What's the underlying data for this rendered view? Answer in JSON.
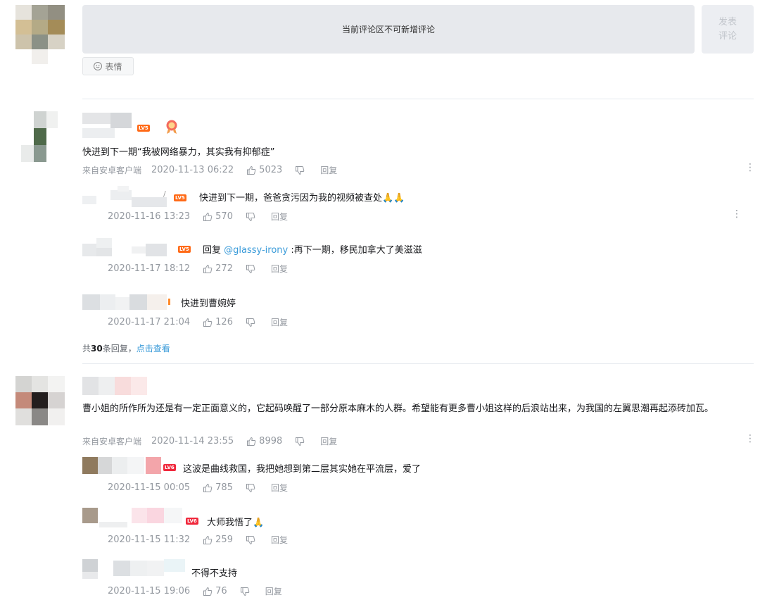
{
  "composer": {
    "disabled_notice": "当前评论区不可新增评论",
    "send_line1": "发表",
    "send_line2": "评论",
    "emoji_label": "表情"
  },
  "thread1": {
    "level": "LV5",
    "text": "快进到下一期“我被网络暴力，其实我有抑郁症”",
    "source": "来自安卓客户端",
    "time": "2020-11-13 06:22",
    "likes": "5023",
    "reply_label": "回复",
    "replies": [
      {
        "level": "LV5",
        "text": "快进到下一期，爸爸贪污因为我的视频被查处",
        "emoji": "🙏🙏",
        "time": "2020-11-16 13:23",
        "likes": "570",
        "reply_label": "回复"
      },
      {
        "level": "LV5",
        "prefix": "回复 ",
        "mention": "@glassy-irony",
        "text": " :再下一期，移民加拿大了美滋滋",
        "time": "2020-11-17 18:12",
        "likes": "272",
        "reply_label": "回复"
      },
      {
        "text": "快进到曹婉婷",
        "time": "2020-11-17 21:04",
        "likes": "126",
        "reply_label": "回复"
      }
    ],
    "footer_prefix": "共",
    "footer_count": "30",
    "footer_suffix": "条回复，",
    "footer_link": "点击查看"
  },
  "thread2": {
    "text": "曹小姐的所作所为还是有一定正面意义的，它起码唤醒了一部分原本麻木的人群。希望能有更多曹小姐这样的后浪站出来，为我国的左翼思潮再起添砖加瓦。",
    "source": "来自安卓客户端",
    "time": "2020-11-14 23:55",
    "likes": "8998",
    "reply_label": "回复",
    "replies": [
      {
        "level": "LV6",
        "text": "这波是曲线救国，我把她想到第二层其实她在平流层，爱了",
        "time": "2020-11-15 00:05",
        "likes": "785",
        "reply_label": "回复"
      },
      {
        "level": "LV6",
        "text": "大师我悟了",
        "emoji": "🙏",
        "time": "2020-11-15 11:32",
        "likes": "259",
        "reply_label": "回复"
      },
      {
        "text": "不得不支持",
        "time": "2020-11-15 19:06",
        "likes": "76",
        "reply_label": "回复"
      }
    ]
  },
  "icons": {
    "like": "thumbs-up-icon",
    "dislike": "thumbs-down-icon",
    "more": "more-vertical-icon",
    "emoji": "smiley-icon",
    "badge": "medal-badge-icon"
  },
  "colors": {
    "link": "#3a9bd9",
    "lv5": "#ff6a17",
    "lv6": "#f0283c",
    "meta": "#9499a0"
  }
}
